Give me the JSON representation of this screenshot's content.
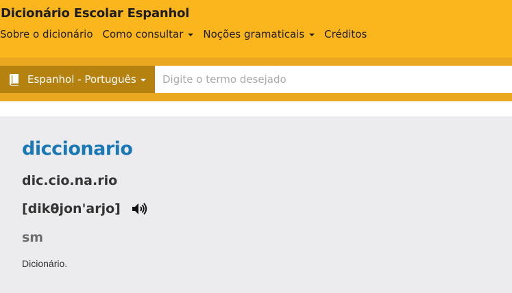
{
  "header": {
    "title": "Dicionário Escolar Espanhol",
    "nav": [
      {
        "label": "Sobre o dicionário",
        "has_dropdown": false
      },
      {
        "label": "Como consultar",
        "has_dropdown": true
      },
      {
        "label": "Noções gramaticais",
        "has_dropdown": true
      },
      {
        "label": "Créditos",
        "has_dropdown": false
      }
    ]
  },
  "search": {
    "language_label": "Espanhol - Português",
    "language_icon": "book-icon",
    "placeholder": "Digite o termo desejado",
    "value": ""
  },
  "entry": {
    "headword": "diccionario",
    "syllables": "dic.cio.na.rio",
    "pronunciation": "[dikθjon'arjo]",
    "audio_icon": "speaker-icon",
    "part_of_speech": "sm",
    "definition": "Dicionário."
  },
  "colors": {
    "header_bg": "#fbb61d",
    "search_band_bg": "#e9a81f",
    "lang_button_bg": "#b5810f",
    "headword": "#1a78b4",
    "content_bg": "#ececee"
  }
}
